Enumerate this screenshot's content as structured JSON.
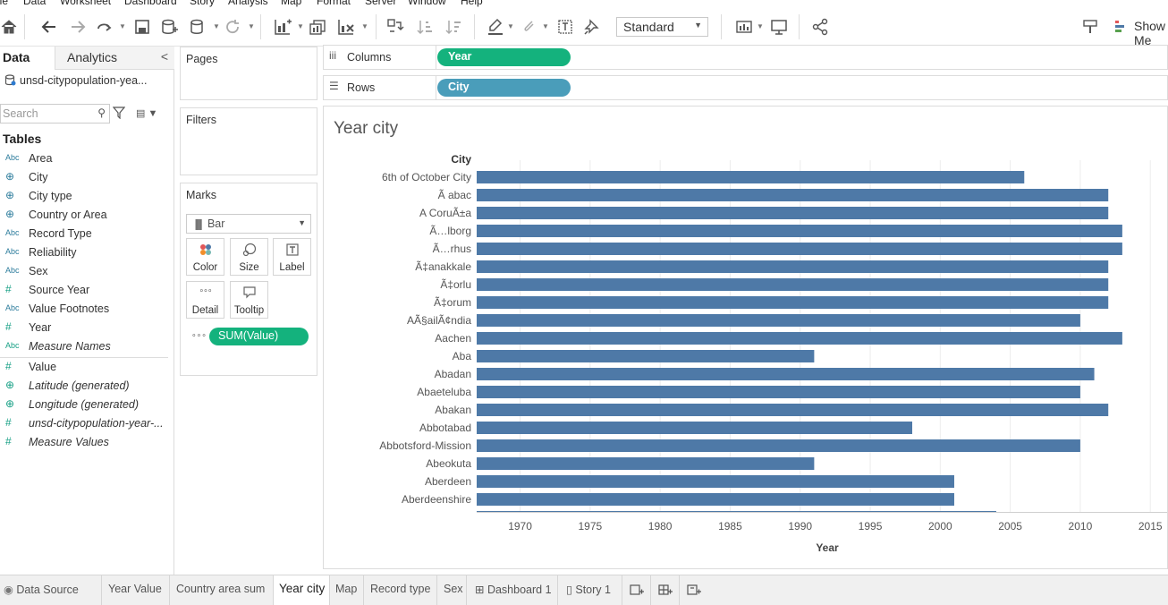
{
  "menu": [
    "ile",
    "Data",
    "Worksheet",
    "Dashboard",
    "Story",
    "Analysis",
    "Map",
    "Format",
    "Server",
    "Window",
    "Help"
  ],
  "toolbar": {
    "mark_size_select": "Standard",
    "show_me": "Show Me"
  },
  "data_pane": {
    "tab_data": "Data",
    "tab_analytics": "Analytics",
    "collapse": "<",
    "datasource": "unsd-citypopulation-yea...",
    "search_placeholder": "Search",
    "tables_heading": "Tables",
    "fields": [
      {
        "type": "Abc",
        "name": "Area",
        "italic": false
      },
      {
        "type": "globe",
        "name": "City",
        "italic": false
      },
      {
        "type": "globe",
        "name": "City type",
        "italic": false
      },
      {
        "type": "globe",
        "name": "Country or Area",
        "italic": false
      },
      {
        "type": "Abc",
        "name": "Record Type",
        "italic": false
      },
      {
        "type": "Abc",
        "name": "Reliability",
        "italic": false
      },
      {
        "type": "Abc",
        "name": "Sex",
        "italic": false
      },
      {
        "type": "hash",
        "name": "Source Year",
        "italic": false
      },
      {
        "type": "Abc",
        "name": "Value Footnotes",
        "italic": false
      },
      {
        "type": "hash",
        "name": "Year",
        "italic": false
      },
      {
        "type": "Abc",
        "name": "Measure Names",
        "italic": true
      },
      {
        "type": "hash",
        "name": "Value",
        "italic": false
      },
      {
        "type": "globe",
        "name": "Latitude (generated)",
        "italic": true
      },
      {
        "type": "globe",
        "name": "Longitude (generated)",
        "italic": true
      },
      {
        "type": "hash",
        "name": "unsd-citypopulation-year-...",
        "italic": true
      },
      {
        "type": "hash",
        "name": "Measure Values",
        "italic": true
      }
    ]
  },
  "cards": {
    "pages": "Pages",
    "filters": "Filters",
    "marks": "Marks",
    "mark_type": "Bar",
    "mark_buttons": {
      "color": "Color",
      "size": "Size",
      "label": "Label",
      "detail": "Detail",
      "tooltip": "Tooltip"
    },
    "mark_pill": "SUM(Value)"
  },
  "shelves": {
    "columns_label": "Columns",
    "columns_pill": "Year",
    "rows_label": "Rows",
    "rows_pill": "City"
  },
  "colors": {
    "bar": "#4e79a7",
    "green_pill": "#14b27d",
    "blue_pill": "#4a9dba"
  },
  "view": {
    "title": "Year city"
  },
  "chart_data": {
    "type": "bar",
    "orientation": "horizontal",
    "title": "Year city",
    "row_header": "City",
    "xlabel": "Year",
    "x_ticks": [
      1970,
      1975,
      1980,
      1985,
      1990,
      1995,
      2000,
      2005,
      2010,
      2015
    ],
    "xlim": [
      1966.9,
      2016.2
    ],
    "categories": [
      "6th of October City",
      "Ã abac",
      "A CoruÃ±a",
      "Ã…lborg",
      "Ã…rhus",
      "Ã‡anakkale",
      "Ã‡orlu",
      "Ã‡orum",
      "AÃ§ailÃ¢ndia",
      "Aachen",
      "Aba",
      "Abadan",
      "Abaeteluba",
      "Abakan",
      "Abbotabad",
      "Abbotsford-Mission",
      "Abeokuta",
      "Aberdeen",
      "Aberdeenshire"
    ],
    "values": [
      2006,
      2012,
      2012,
      2013,
      2013,
      2012,
      2012,
      2012,
      2010,
      2013,
      1991,
      2011,
      2010,
      2012,
      1998,
      2010,
      1991,
      2001,
      2001
    ],
    "partial_next_value": 2004,
    "grid": true
  },
  "bottom_tabs": [
    "Data Source",
    "Year Value",
    "Country area sum",
    "Year city",
    "Map",
    "Record type",
    "Sex",
    "Dashboard 1",
    "Story 1"
  ]
}
